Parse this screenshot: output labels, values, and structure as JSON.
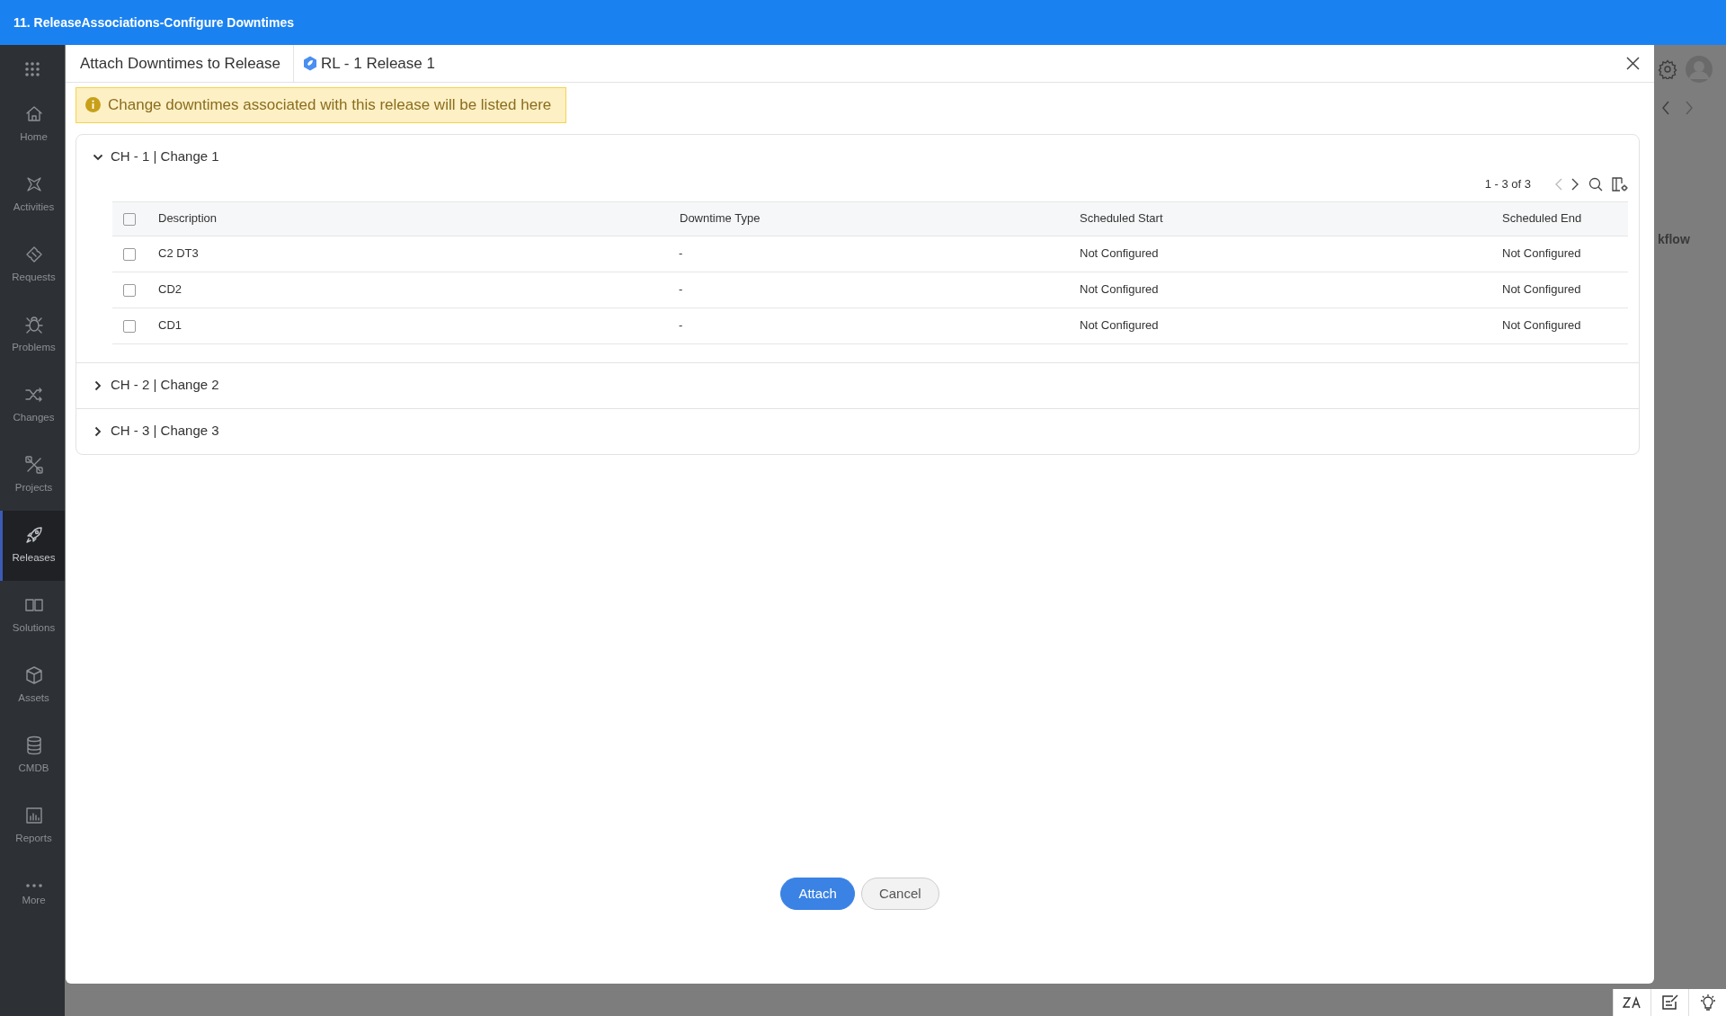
{
  "app_bar": {
    "title": "11. ReleaseAssociations-Configure Downtimes"
  },
  "sidebar": {
    "items": [
      {
        "label": "Home",
        "selected": false
      },
      {
        "label": "Activities",
        "selected": false
      },
      {
        "label": "Requests",
        "selected": false
      },
      {
        "label": "Problems",
        "selected": false
      },
      {
        "label": "Changes",
        "selected": false
      },
      {
        "label": "Projects",
        "selected": false
      },
      {
        "label": "Releases",
        "selected": true
      },
      {
        "label": "Solutions",
        "selected": false
      },
      {
        "label": "Assets",
        "selected": false
      },
      {
        "label": "CMDB",
        "selected": false
      },
      {
        "label": "Reports",
        "selected": false
      },
      {
        "label": "More",
        "selected": false
      }
    ]
  },
  "background_page": {
    "partial_text": "kflow"
  },
  "modal": {
    "title": "Attach Downtimes to Release",
    "release": "RL - 1 Release 1",
    "notice": "Change downtimes associated with this release will be listed here",
    "groups": [
      {
        "title": "CH - 1 | Change 1",
        "expanded": true,
        "pager": "1 - 3 of 3",
        "select_all_checked": false,
        "columns": [
          "Description",
          "Downtime Type",
          "Scheduled Start",
          "Scheduled End"
        ],
        "rows": [
          {
            "checked": false,
            "cells": [
              "C2 DT3",
              "-",
              "Not Configured",
              "Not Configured"
            ]
          },
          {
            "checked": false,
            "cells": [
              "CD2",
              "-",
              "Not Configured",
              "Not Configured"
            ]
          },
          {
            "checked": false,
            "cells": [
              "CD1",
              "-",
              "Not Configured",
              "Not Configured"
            ]
          }
        ]
      },
      {
        "title": "CH - 2 | Change 2",
        "expanded": false
      },
      {
        "title": "CH - 3 | Change 3",
        "expanded": false
      }
    ],
    "buttons": [
      {
        "label": "Attach",
        "kind": "primary"
      },
      {
        "label": "Cancel",
        "kind": "secondary"
      }
    ]
  }
}
